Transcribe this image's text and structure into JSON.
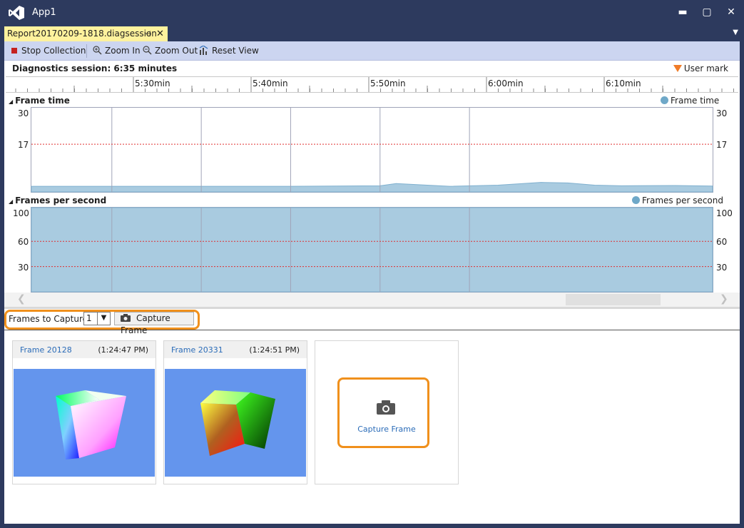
{
  "app": {
    "title": "App1"
  },
  "window_controls": {
    "minimize": "▬",
    "maximize": "▢",
    "close": "✕"
  },
  "document_tab": {
    "label": "Report20170209-1818.diagsession",
    "pin": "⊣",
    "close": "✕"
  },
  "toolbar": {
    "stop_collection": "Stop Collection",
    "zoom_in": "Zoom In",
    "zoom_out": "Zoom Out",
    "reset_view": "Reset View"
  },
  "session": {
    "label": "Diagnostics session: 6:35 minutes",
    "user_mark": "User mark"
  },
  "ruler": {
    "labels": [
      "5:30min",
      "5:40min",
      "5:50min",
      "6:00min",
      "6:10min"
    ]
  },
  "frame_time": {
    "title": "Frame time",
    "legend": "Frame time",
    "ticks": [
      "30",
      "17"
    ]
  },
  "fps": {
    "title": "Frames per second",
    "legend": "Frames per second",
    "ticks": [
      "100",
      "60",
      "30"
    ]
  },
  "colors": {
    "accent_highlight": "#f0901c",
    "series_fill": "#a9cbe0",
    "threshold_line": "#e03030"
  },
  "chart_data": [
    {
      "type": "area",
      "title": "Frame time",
      "ylim": [
        0,
        30
      ],
      "threshold": 17,
      "x_min": [
        5.35,
        5.5,
        5.67,
        5.83,
        6.0,
        6.03,
        6.13,
        6.22,
        6.3,
        6.35,
        6.4,
        6.45,
        6.55,
        6.62
      ],
      "series": [
        {
          "name": "Frame time",
          "values": [
            2,
            2,
            2,
            2,
            2.2,
            3,
            2,
            2.4,
            3.4,
            3.2,
            2.4,
            2.2,
            2.3,
            2.1
          ]
        }
      ]
    },
    {
      "type": "area",
      "title": "Frames per second",
      "ylim": [
        0,
        100
      ],
      "threshold": 60,
      "x_min": [
        5.35,
        6.62
      ],
      "series": [
        {
          "name": "Frames per second",
          "values": [
            100,
            100
          ]
        }
      ]
    }
  ],
  "capture": {
    "frames_label": "Frames to Capture:",
    "frames_value": "1",
    "button_label": "Capture Frame"
  },
  "frames": [
    {
      "name": "Frame 20128",
      "time": "(1:24:47 PM)"
    },
    {
      "name": "Frame 20331",
      "time": "(1:24:51 PM)"
    }
  ],
  "capture_card": {
    "label": "Capture Frame"
  }
}
